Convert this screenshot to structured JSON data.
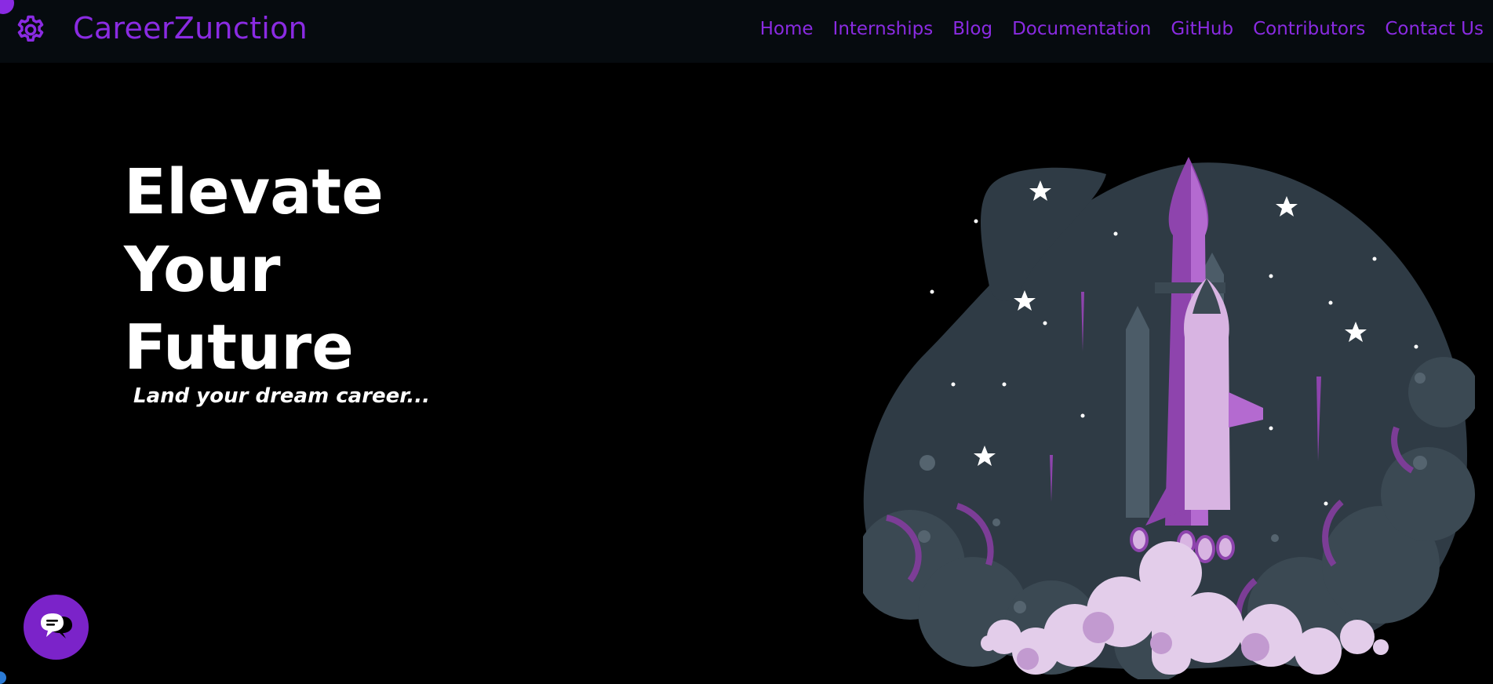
{
  "header": {
    "brand": "CareerZunction",
    "logo_icon": "gear-icon",
    "nav": [
      {
        "label": "Home"
      },
      {
        "label": "Internships"
      },
      {
        "label": "Blog"
      },
      {
        "label": "Documentation"
      },
      {
        "label": "GitHub"
      },
      {
        "label": "Contributors"
      },
      {
        "label": "Contact Us"
      }
    ]
  },
  "hero": {
    "title_lines": [
      "Elevate",
      "Your",
      "Future"
    ],
    "tagline": "Land your dream career..."
  },
  "illustration": {
    "subject": "rocket-launch-illustration"
  },
  "chat": {
    "icon": "chat-bubbles-icon"
  },
  "colors": {
    "accent": "#8a2be2",
    "navbar_bg": "#060b0f",
    "page_bg": "#000000",
    "chat_button": "#7b23c9",
    "blob": "#2f3b45",
    "rocket_purple": "#8e44ad",
    "rocket_light": "#d8b4e2"
  }
}
